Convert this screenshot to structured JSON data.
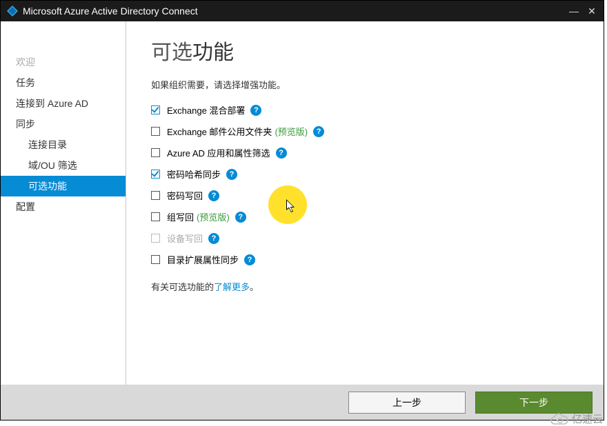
{
  "window": {
    "title": "Microsoft Azure Active Directory Connect",
    "minimize": "—",
    "close": "✕"
  },
  "sidebar": {
    "items": [
      {
        "label": "欢迎",
        "kind": "disabled"
      },
      {
        "label": "任务",
        "kind": "normal"
      },
      {
        "label": "连接到 Azure AD",
        "kind": "normal"
      },
      {
        "label": "同步",
        "kind": "normal"
      },
      {
        "label": "连接目录",
        "kind": "sub"
      },
      {
        "label": "域/OU 筛选",
        "kind": "sub"
      },
      {
        "label": "可选功能",
        "kind": "sub active"
      },
      {
        "label": "配置",
        "kind": "normal"
      }
    ]
  },
  "main": {
    "title_light": "可选",
    "title_heavy": "功能",
    "intro": "如果组织需要，请选择增强功能。",
    "options": [
      {
        "label": "Exchange 混合部署",
        "checked": true,
        "preview": false,
        "disabled": false
      },
      {
        "label": "Exchange 邮件公用文件夹",
        "checked": false,
        "preview": true,
        "disabled": false
      },
      {
        "label": "Azure AD 应用和属性筛选",
        "checked": false,
        "preview": false,
        "disabled": false
      },
      {
        "label": "密码哈希同步",
        "checked": true,
        "preview": false,
        "disabled": false
      },
      {
        "label": "密码写回",
        "checked": false,
        "preview": false,
        "disabled": false
      },
      {
        "label": "组写回",
        "checked": false,
        "preview": true,
        "disabled": false
      },
      {
        "label": "设备写回",
        "checked": false,
        "preview": false,
        "disabled": true
      },
      {
        "label": "目录扩展属性同步",
        "checked": false,
        "preview": false,
        "disabled": false
      }
    ],
    "preview_label": "(预览版)",
    "help_glyph": "?",
    "learn_prefix": "有关可选功能的",
    "learn_link": "了解更多",
    "learn_suffix": "。"
  },
  "footer": {
    "prev": "上一步",
    "next": "下一步"
  },
  "watermark": "亿速云"
}
